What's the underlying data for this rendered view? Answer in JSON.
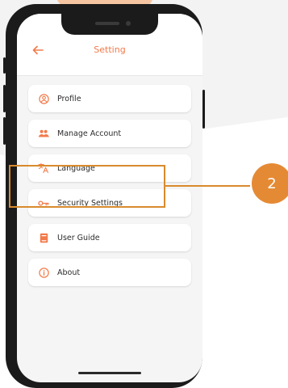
{
  "screen": {
    "title": "Setting",
    "accent_color": "#f27a4a"
  },
  "menu": {
    "items": [
      {
        "label": "Profile",
        "icon": "user-circle-icon"
      },
      {
        "label": "Manage Account",
        "icon": "users-icon"
      },
      {
        "label": "Language",
        "icon": "translate-icon"
      },
      {
        "label": "Security Settings",
        "icon": "key-icon"
      },
      {
        "label": "User Guide",
        "icon": "book-icon"
      },
      {
        "label": "About",
        "icon": "info-icon"
      }
    ]
  },
  "annotation": {
    "step_number": "2",
    "highlight_color": "#d98a2d",
    "badge_color": "#e58a34"
  }
}
